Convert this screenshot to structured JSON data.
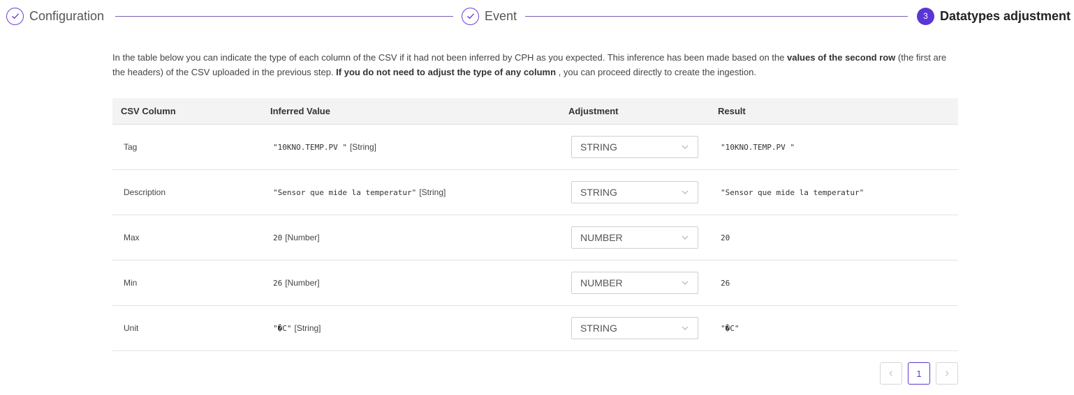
{
  "stepper": {
    "steps": [
      {
        "label": "Configuration",
        "state": "done",
        "icon": "check-icon"
      },
      {
        "label": "Event",
        "state": "done",
        "icon": "check-icon"
      },
      {
        "label": "Datatypes adjustment",
        "state": "active",
        "number": "3"
      }
    ]
  },
  "intro": {
    "part1": "In the table below you can indicate the type of each column of the CSV if it had not been inferred by CPH as you expected. This inference has been made based on the ",
    "bold1": "values of the second row",
    "part2": " (the first are the headers) of the CSV uploaded in the previous step. ",
    "bold2": "If you do not need to adjust the type of any column",
    "part3": " , you can proceed directly to create the ingestion."
  },
  "table": {
    "headers": [
      "CSV Column",
      "Inferred Value",
      "Adjustment",
      "Result"
    ],
    "rows": [
      {
        "column": "Tag",
        "value": "\"10KNO.TEMP.PV \"",
        "type": "[String]",
        "adjustment": "STRING",
        "result": "\"10KNO.TEMP.PV \""
      },
      {
        "column": "Description",
        "value": "\"Sensor que mide la temperatur\"",
        "type": "[String]",
        "adjustment": "STRING",
        "result": "\"Sensor que mide la temperatur\""
      },
      {
        "column": "Max",
        "value": "20",
        "type": "[Number]",
        "adjustment": "NUMBER",
        "result": "20"
      },
      {
        "column": "Min",
        "value": "26",
        "type": "[Number]",
        "adjustment": "NUMBER",
        "result": "26"
      },
      {
        "column": "Unit",
        "value": "\"�C\"",
        "type": "[String]",
        "adjustment": "STRING",
        "result": "\"�C\""
      }
    ]
  },
  "pagination": {
    "current_page": "1",
    "prev_icon": "chevron-left-icon",
    "next_icon": "chevron-right-icon"
  },
  "colors": {
    "accent": "#5b35d5",
    "line": "#7a5fb0",
    "header_bg": "#f3f3f3"
  }
}
